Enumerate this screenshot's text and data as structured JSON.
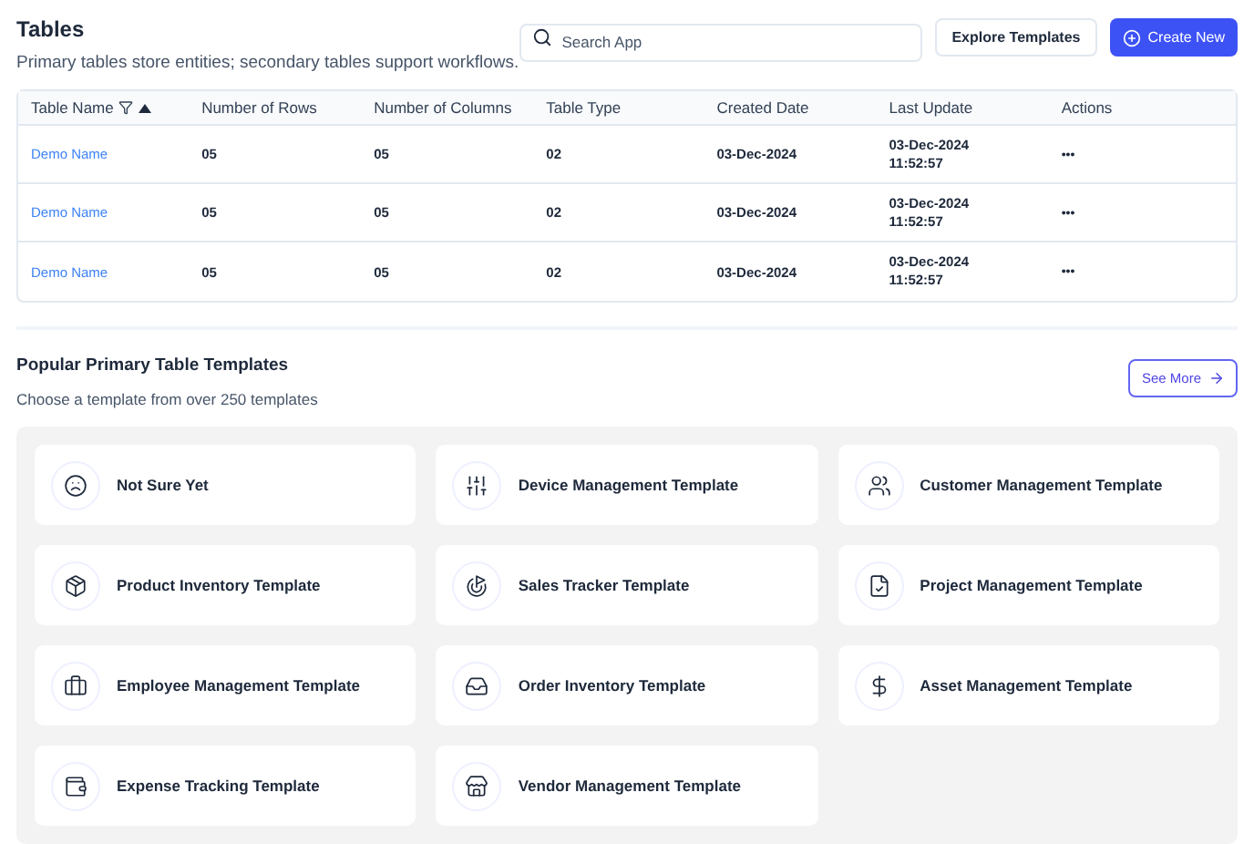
{
  "header": {
    "title": "Tables",
    "subtitle": "Primary tables store entities; secondary tables support workflows."
  },
  "search": {
    "placeholder": "Search App"
  },
  "buttons": {
    "explore": "Explore Templates",
    "create": "Create New"
  },
  "table": {
    "columns": [
      "Table Name",
      "Number of Rows",
      "Number of Columns",
      "Table Type",
      "Created Date",
      "Last Update",
      "Actions"
    ],
    "rows": [
      {
        "name": "Demo Name",
        "rows": "05",
        "columns": "05",
        "type": "02",
        "created": "03-Dec-2024",
        "updated_date": "03-Dec-2024",
        "updated_time": "11:52:57",
        "actions": "•••"
      },
      {
        "name": "Demo Name",
        "rows": "05",
        "columns": "05",
        "type": "02",
        "created": "03-Dec-2024",
        "updated_date": "03-Dec-2024",
        "updated_time": "11:52:57",
        "actions": "•••"
      },
      {
        "name": "Demo Name",
        "rows": "05",
        "columns": "05",
        "type": "02",
        "created": "03-Dec-2024",
        "updated_date": "03-Dec-2024",
        "updated_time": "11:52:57",
        "actions": "•••"
      }
    ]
  },
  "templates": {
    "title": "Popular Primary Table Templates",
    "subtitle": "Choose a template from over 250 templates",
    "see_more": "See More",
    "items": [
      "Not Sure Yet",
      "Device Management Template",
      "Customer Management Template",
      "Product Inventory Template",
      "Sales Tracker Template",
      "Project Management Template",
      "Employee Management Template",
      "Order Inventory Template",
      "Asset Management Template",
      "Expense Tracking Template",
      "Vendor Management Template"
    ]
  }
}
